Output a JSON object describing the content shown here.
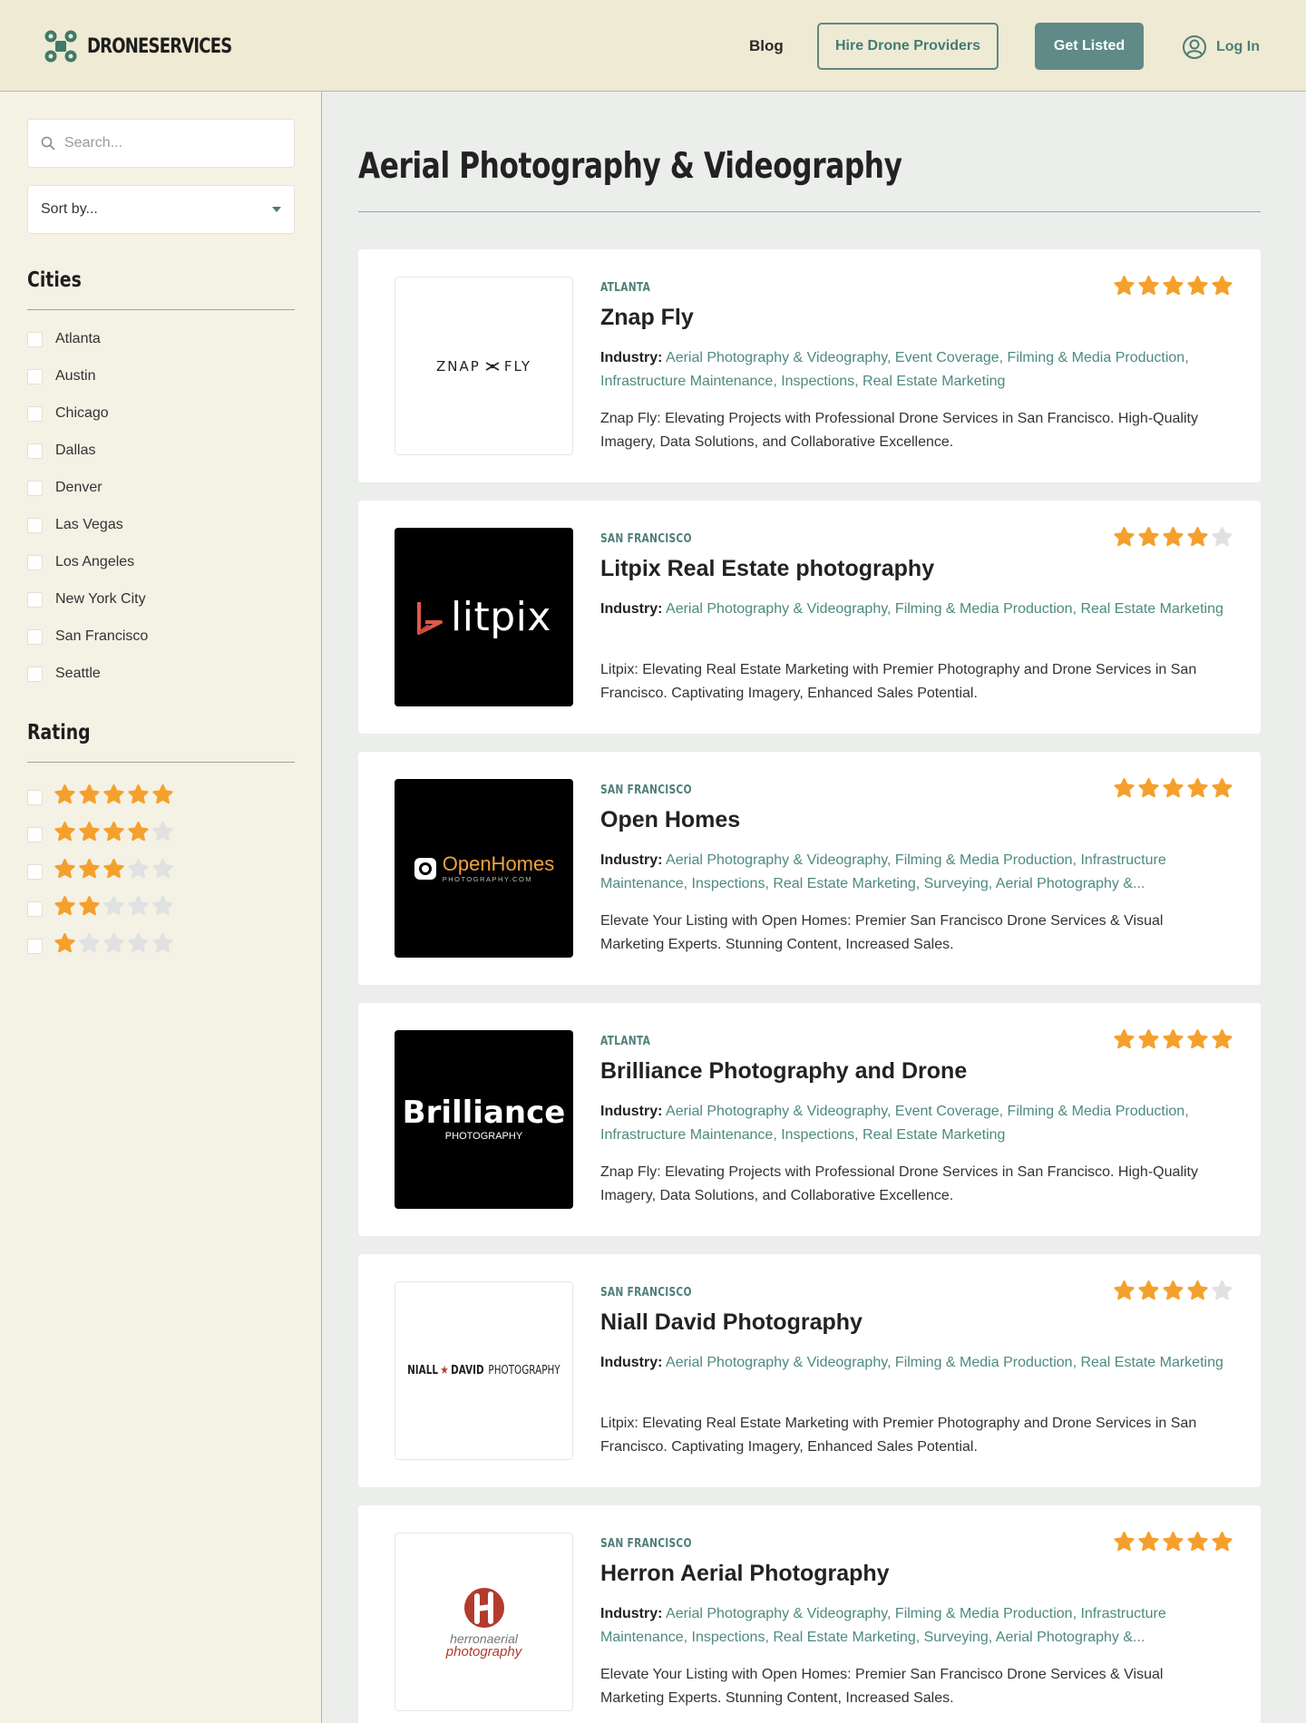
{
  "colors": {
    "star_filled": "#f5a02c",
    "star_empty": "#dfe1e2",
    "accent": "#5f8a87",
    "header_bg": "#efead3",
    "sidebar_bg": "#f4f1e5"
  },
  "header": {
    "brand": "DRONESERVICES",
    "nav_blog": "Blog",
    "hire_button": "Hire Drone Providers",
    "listed_button": "Get Listed",
    "login": "Log In"
  },
  "sidebar": {
    "search_placeholder": "Search...",
    "sort_label": "Sort by...",
    "cities_title": "Cities",
    "cities": [
      "Atlanta",
      "Austin",
      "Chicago",
      "Dallas",
      "Denver",
      "Las Vegas",
      "Los Angeles",
      "New York City",
      "San Francisco",
      "Seattle"
    ],
    "rating_title": "Rating",
    "rating_levels": [
      5,
      4,
      3,
      2,
      1
    ]
  },
  "main": {
    "title": "Aerial Photography & Videography",
    "industry_label": "Industry:",
    "listings": [
      {
        "city": "ATLANTA",
        "name": "Znap Fly",
        "rating": 5,
        "logo": {
          "style": "light",
          "icon": "znapfly-logo",
          "text_left": "ZNAP",
          "text_right": "FLY"
        },
        "industries": "Aerial Photography & Videography, Event Coverage, Filming & Media Production, Infrastructure Maintenance, Inspections, Real Estate Marketing",
        "description": "Znap Fly: Elevating Projects with Professional Drone Services in San Francisco. High-Quality Imagery, Data Solutions, and Collaborative Excellence."
      },
      {
        "city": "SAN FRANCISCO",
        "name": "Litpix Real Estate photography",
        "rating": 4,
        "logo": {
          "style": "dark",
          "icon": "litpix-logo",
          "text": "litpix"
        },
        "industries": "Aerial Photography & Videography, Filming & Media Production, Real Estate Marketing",
        "description": "Litpix: Elevating Real Estate Marketing with Premier Photography and Drone Services in San Francisco. Captivating Imagery, Enhanced Sales Potential."
      },
      {
        "city": "SAN FRANCISCO",
        "name": "Open Homes",
        "rating": 5,
        "logo": {
          "style": "dark",
          "icon": "openhomes-logo",
          "text": "OpenHomes",
          "subtext": "PHOTOGRAPHY.COM"
        },
        "industries": "Aerial Photography & Videography, Filming & Media Production, Infrastructure Maintenance, Inspections, Real Estate Marketing, Surveying, Aerial Photography &...",
        "description": "Elevate Your Listing with Open Homes: Premier San Francisco Drone Services & Visual Marketing Experts. Stunning Content, Increased Sales."
      },
      {
        "city": "ATLANTA",
        "name": "Brilliance Photography and Drone",
        "rating": 5,
        "logo": {
          "style": "dark",
          "icon": "brilliance-logo",
          "text": "Brilliance",
          "subtext": "PHOTOGRAPHY"
        },
        "industries": "Aerial Photography & Videography, Event Coverage, Filming & Media Production, Infrastructure Maintenance, Inspections, Real Estate Marketing",
        "description": "Znap Fly: Elevating Projects with Professional Drone Services in San Francisco. High-Quality Imagery, Data Solutions, and Collaborative Excellence."
      },
      {
        "city": "SAN FRANCISCO",
        "name": "Niall David Photography",
        "rating": 4,
        "logo": {
          "style": "light",
          "icon": "nialldavid-logo",
          "text_left": "NIALL",
          "text_mid": "DAVID",
          "text_right": "PHOTOGRAPHY"
        },
        "industries": "Aerial Photography & Videography, Filming & Media Production, Real Estate Marketing",
        "description": "Litpix: Elevating Real Estate Marketing with Premier Photography and Drone Services in San Francisco. Captivating Imagery, Enhanced Sales Potential."
      },
      {
        "city": "SAN FRANCISCO",
        "name": "Herron Aerial Photography",
        "rating": 5,
        "logo": {
          "style": "light",
          "icon": "herron-logo",
          "text": "herronaerial",
          "subtext": "photography"
        },
        "industries": "Aerial Photography & Videography, Filming & Media Production, Infrastructure Maintenance, Inspections, Real Estate Marketing, Surveying, Aerial Photography &...",
        "description": "Elevate Your Listing with Open Homes: Premier San Francisco Drone Services & Visual Marketing Experts. Stunning Content, Increased Sales."
      }
    ]
  }
}
